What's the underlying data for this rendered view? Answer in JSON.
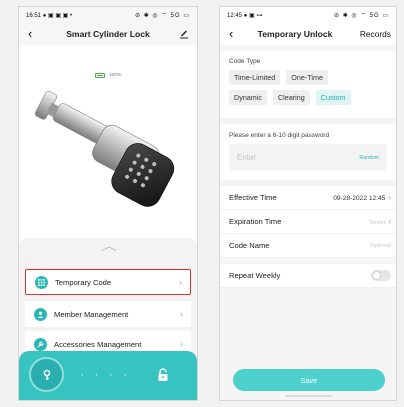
{
  "left_screen": {
    "status": {
      "time": "16:51",
      "icons_left": "● ▣ ▣ ▣ •",
      "icons_right": "⊘ ✱ ◎ ⌔ 5G ▭"
    },
    "nav": {
      "title": "Smart Cylinder Lock"
    },
    "battery": {
      "text": "100%",
      "level_percent": 100
    },
    "menu": [
      {
        "label": "Temporary Code",
        "icon": "grid-icon"
      },
      {
        "label": "Member Management",
        "icon": "person-icon"
      },
      {
        "label": "Accessories Management",
        "icon": "wrench-icon"
      }
    ],
    "bottom_bar": {
      "arrows": "› › › ›"
    },
    "colors": {
      "accent": "#37c4c1",
      "highlight": "#d9322e"
    }
  },
  "right_screen": {
    "status": {
      "time": "12:45",
      "icons_left": "● ▣ ⊶",
      "icons_right": "⊘ ✱ ◎ ⌔ 5G ▭"
    },
    "nav": {
      "title": "Temporary Unlock",
      "records": "Records"
    },
    "code_type": {
      "label": "Code Type",
      "options": [
        "Time-Limited",
        "One-Time",
        "Dynamic",
        "Clearing",
        "Custom"
      ],
      "selected": "Custom"
    },
    "password": {
      "label": "Please enter a 6-10 digit password",
      "placeholder": "Enter",
      "random": "Random"
    },
    "effective_time": {
      "label": "Effective Time",
      "value": "09-28-2022 12:45"
    },
    "expiration_time": {
      "label": "Expiration Time",
      "value": "Select"
    },
    "code_name": {
      "label": "Code Name",
      "value": "Optional"
    },
    "repeat_weekly": {
      "label": "Repeat Weekly",
      "on": false
    },
    "save": "Save"
  }
}
